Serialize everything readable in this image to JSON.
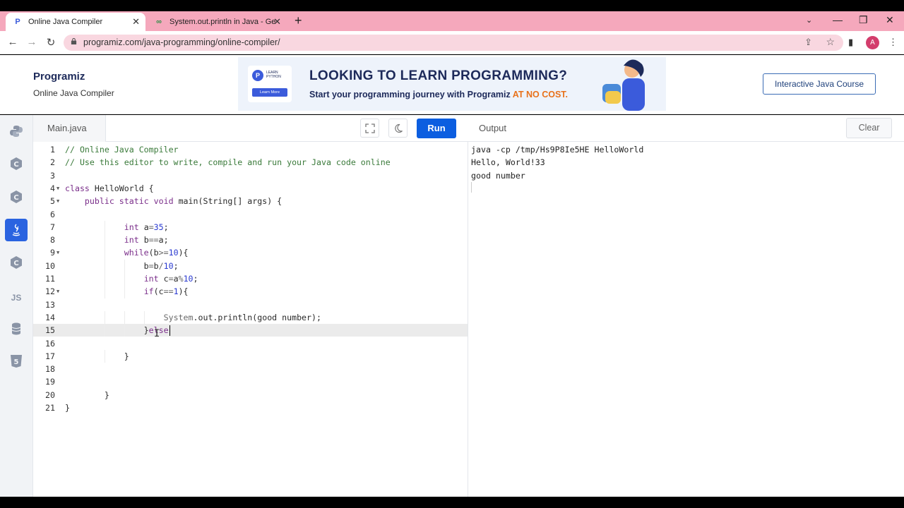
{
  "browser": {
    "tabs": [
      {
        "title": "Online Java Compiler",
        "active": true
      },
      {
        "title": "System.out.println in Java - Geek",
        "active": false
      }
    ],
    "url": "programiz.com/java-programming/online-compiler/",
    "avatar_letter": "A"
  },
  "header": {
    "logo": "Programiz",
    "subtitle": "Online Java Compiler",
    "banner": {
      "badge_line1": "LEARN",
      "badge_line2": "PYTHON",
      "badge_button": "Learn More",
      "headline": "LOOKING TO LEARN PROGRAMMING?",
      "subline": "Start your programming journey with Programiz",
      "highlight": "AT NO COST."
    },
    "course_button": "Interactive Java Course"
  },
  "sidebar": {
    "languages": [
      {
        "name": "python-icon",
        "label": "",
        "active": false
      },
      {
        "name": "c-icon",
        "label": "",
        "active": false
      },
      {
        "name": "cpp-icon",
        "label": "",
        "active": false
      },
      {
        "name": "java-icon",
        "label": "",
        "active": true
      },
      {
        "name": "csharp-icon",
        "label": "",
        "active": false
      },
      {
        "name": "js-icon",
        "label": "JS",
        "active": false
      },
      {
        "name": "sql-icon",
        "label": "",
        "active": false
      },
      {
        "name": "html5-icon",
        "label": "",
        "active": false
      }
    ]
  },
  "editor": {
    "file_tab": "Main.java",
    "run_label": "Run",
    "current_line": 15,
    "lines": [
      "// Online Java Compiler",
      "// Use this editor to write, compile and run your Java code online",
      "",
      "class HelloWorld {",
      "    public static void main(String[] args) {",
      "",
      "            int a=35;",
      "            int b==a;",
      "            while(b>=10){",
      "                b=b/10;",
      "                int c=a%10;",
      "                if(c==1){",
      "",
      "                    System.out.println(good number);",
      "                }else",
      "",
      "            }",
      "",
      "",
      "        }",
      "}"
    ],
    "fold_lines": [
      4,
      5,
      9,
      12
    ]
  },
  "output": {
    "title": "Output",
    "clear_label": "Clear",
    "lines": [
      "java -cp /tmp/Hs9P8Ie5HE HelloWorld",
      "Hello, World!33",
      "good number"
    ]
  },
  "colors": {
    "tabstrip": "#f5a8bc",
    "run_button": "#0c5ee0",
    "active_language": "#2a63e0",
    "banner_highlight": "#e8711a"
  }
}
